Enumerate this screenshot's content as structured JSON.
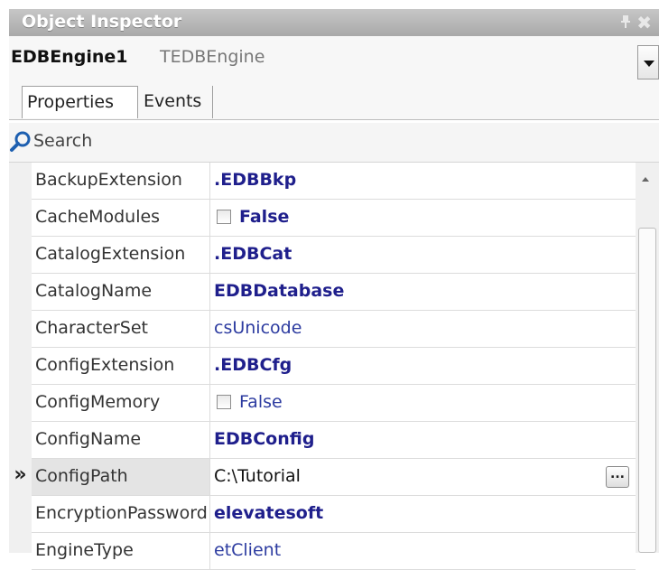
{
  "window": {
    "title": "Object Inspector",
    "pin_icon": "pin-icon",
    "close_icon": "close-icon"
  },
  "component": {
    "name": "EDBEngine1",
    "type": "TEDBEngine",
    "dropdown_icon": "chevron-down-icon"
  },
  "tabs": [
    {
      "label": "Properties",
      "active": true
    },
    {
      "label": "Events",
      "active": false
    }
  ],
  "search": {
    "label": "Search",
    "icon": "search-icon"
  },
  "properties": [
    {
      "name": "BackupExtension",
      "value": ".EDBBkp",
      "style": "bold"
    },
    {
      "name": "CacheModules",
      "value": "False",
      "style": "bold",
      "checkbox": true,
      "checked": false
    },
    {
      "name": "CatalogExtension",
      "value": ".EDBCat",
      "style": "bold"
    },
    {
      "name": "CatalogName",
      "value": "EDBDatabase",
      "style": "bold"
    },
    {
      "name": "CharacterSet",
      "value": "csUnicode",
      "style": "normal"
    },
    {
      "name": "ConfigExtension",
      "value": ".EDBCfg",
      "style": "bold"
    },
    {
      "name": "ConfigMemory",
      "value": "False",
      "style": "normal",
      "checkbox": true,
      "checked": false
    },
    {
      "name": "ConfigName",
      "value": "EDBConfig",
      "style": "bold"
    },
    {
      "name": "ConfigPath",
      "value": "C:\\Tutorial",
      "style": "selected",
      "selected": true,
      "ellipsis": "..."
    },
    {
      "name": "EncryptionPassword",
      "value": "elevatesoft",
      "style": "bold"
    },
    {
      "name": "EngineType",
      "value": "etClient",
      "style": "normal"
    }
  ],
  "selected_marker": "»",
  "colors": {
    "title_bar": "#b4b4b4",
    "value_text": "#1f1f8c",
    "selected_name_bg": "#e4e4e4"
  }
}
